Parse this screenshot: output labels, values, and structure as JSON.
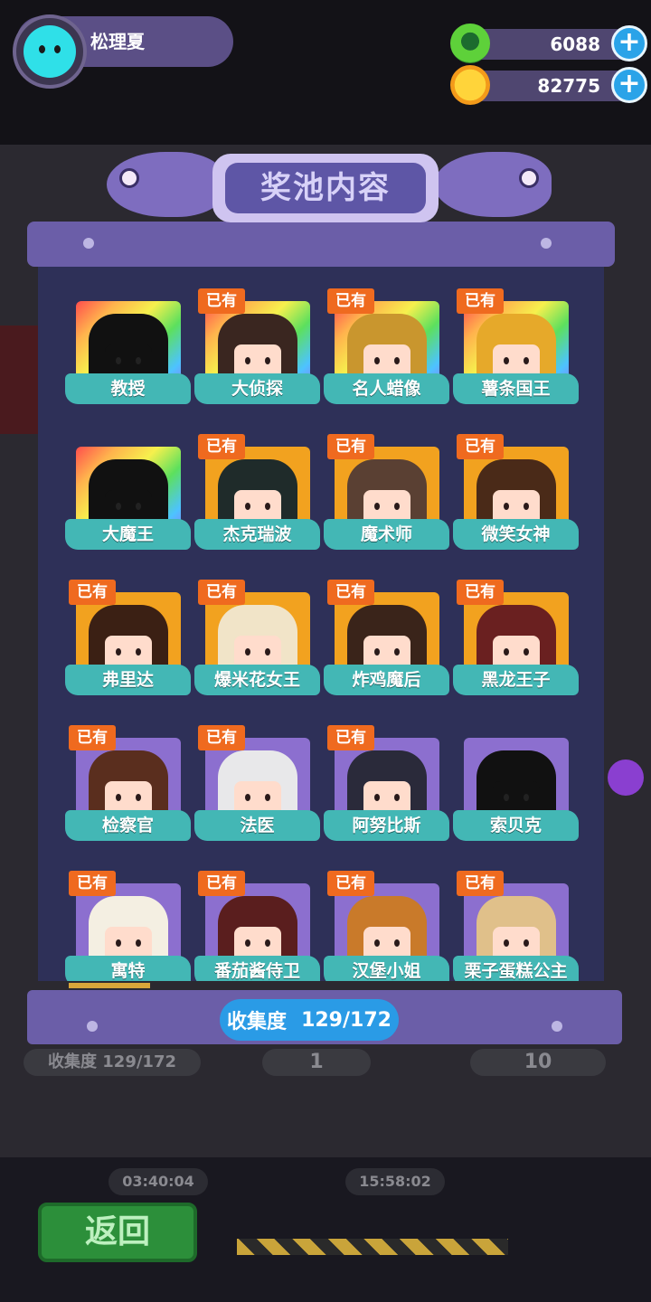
{
  "player": {
    "name": "松理夏"
  },
  "currencies": [
    {
      "icon": "green-gem-coin-icon",
      "value": "6088"
    },
    {
      "icon": "gold-planet-coin-icon",
      "value": "82775"
    }
  ],
  "panel": {
    "title": "奖池内容",
    "progress_label": "收集度",
    "progress_value": "129/172",
    "owned_badge": "已有"
  },
  "cards": [
    {
      "name": "教授",
      "owned": false,
      "rarity": "rainbow",
      "hair": "#111111",
      "silhouette": true
    },
    {
      "name": "大侦探",
      "owned": true,
      "rarity": "rainbow",
      "hair": "#3a2620"
    },
    {
      "name": "名人蜡像",
      "owned": true,
      "rarity": "rainbow",
      "hair": "#c9962e"
    },
    {
      "name": "薯条国王",
      "owned": true,
      "rarity": "rainbow",
      "hair": "#e6a92a"
    },
    {
      "name": "大魔王",
      "owned": false,
      "rarity": "rainbow",
      "hair": "#111111",
      "silhouette": true
    },
    {
      "name": "杰克瑞波",
      "owned": true,
      "rarity": "gold",
      "hair": "#1f2b2a"
    },
    {
      "name": "魔术师",
      "owned": true,
      "rarity": "gold",
      "hair": "#5a4033"
    },
    {
      "name": "微笑女神",
      "owned": true,
      "rarity": "gold",
      "hair": "#4a2a18"
    },
    {
      "name": "弗里达",
      "owned": true,
      "rarity": "gold",
      "hair": "#3b2014"
    },
    {
      "name": "爆米花女王",
      "owned": true,
      "rarity": "gold",
      "hair": "#f1e4c8"
    },
    {
      "name": "炸鸡魔后",
      "owned": true,
      "rarity": "gold",
      "hair": "#3a241a"
    },
    {
      "name": "黑龙王子",
      "owned": true,
      "rarity": "gold",
      "hair": "#6a2020"
    },
    {
      "name": "检察官",
      "owned": true,
      "rarity": "purple",
      "hair": "#5a2e1e"
    },
    {
      "name": "法医",
      "owned": true,
      "rarity": "purple",
      "hair": "#e8e8ea"
    },
    {
      "name": "阿努比斯",
      "owned": true,
      "rarity": "purple",
      "hair": "#2a2a3a"
    },
    {
      "name": "索贝克",
      "owned": false,
      "rarity": "purple",
      "hair": "#111111",
      "silhouette": true
    },
    {
      "name": "寓特",
      "owned": true,
      "rarity": "purple",
      "hair": "#f4efe2"
    },
    {
      "name": "番茄酱侍卫",
      "owned": true,
      "rarity": "purple",
      "hair": "#5a1e1e"
    },
    {
      "name": "汉堡小姐",
      "owned": true,
      "rarity": "purple",
      "hair": "#c97a2a"
    },
    {
      "name": "栗子蛋糕公主",
      "owned": true,
      "rarity": "purple",
      "hair": "#e0c08a"
    }
  ],
  "background": {
    "behind_progress": "收集度 129/172",
    "count_a": "1",
    "count_b": "10",
    "timer_a": "03:40:04",
    "timer_b": "15:58:02",
    "back_button": "返回"
  },
  "colors": {
    "panel_header": "#6b5ea8",
    "panel_body": "#2e3058",
    "name_banner": "#43b7b5",
    "owned_badge": "#ef6a1f",
    "progress_pill": "#2a9be6"
  }
}
